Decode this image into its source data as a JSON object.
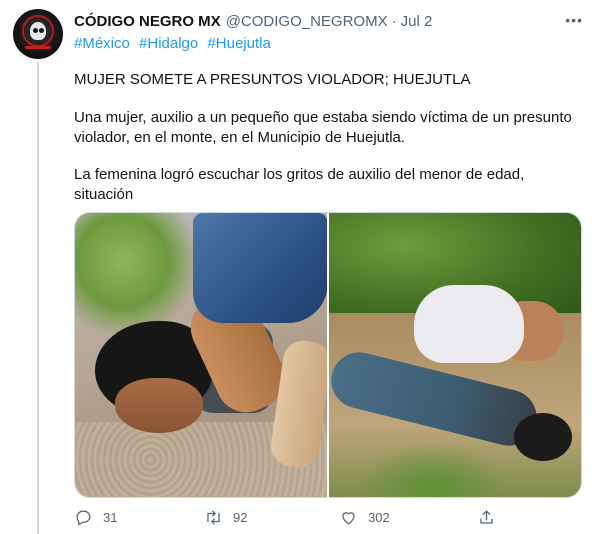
{
  "tweet": {
    "display_name": "CÓDIGO NEGRO MX",
    "handle": "@CODIGO_NEGROMX",
    "separator": "·",
    "date": "Jul 2",
    "more_label": "•••",
    "hashtags": [
      "#México",
      "#Hidalgo",
      "#Huejutla"
    ],
    "paragraphs": [
      "MUJER SOMETE A PRESUNTOS VIOLADOR; HUEJUTLA",
      "Una mujer, auxilio a un pequeño que estaba siendo víctima de un presunto violador, en el monte, en el Municipio de Huejutla.",
      "La femenina logró escuchar los gritos de auxilio del menor de edad, situación"
    ]
  },
  "actions": {
    "reply_count": "31",
    "retweet_count": "92",
    "like_count": "302"
  },
  "icons": {
    "reply": "reply-icon",
    "retweet": "retweet-icon",
    "like": "heart-icon",
    "share": "share-icon",
    "more": "more-icon"
  },
  "colors": {
    "link": "#1d9bf0",
    "text": "#0f1419",
    "secondary": "#536471",
    "border": "#cfd9de"
  }
}
